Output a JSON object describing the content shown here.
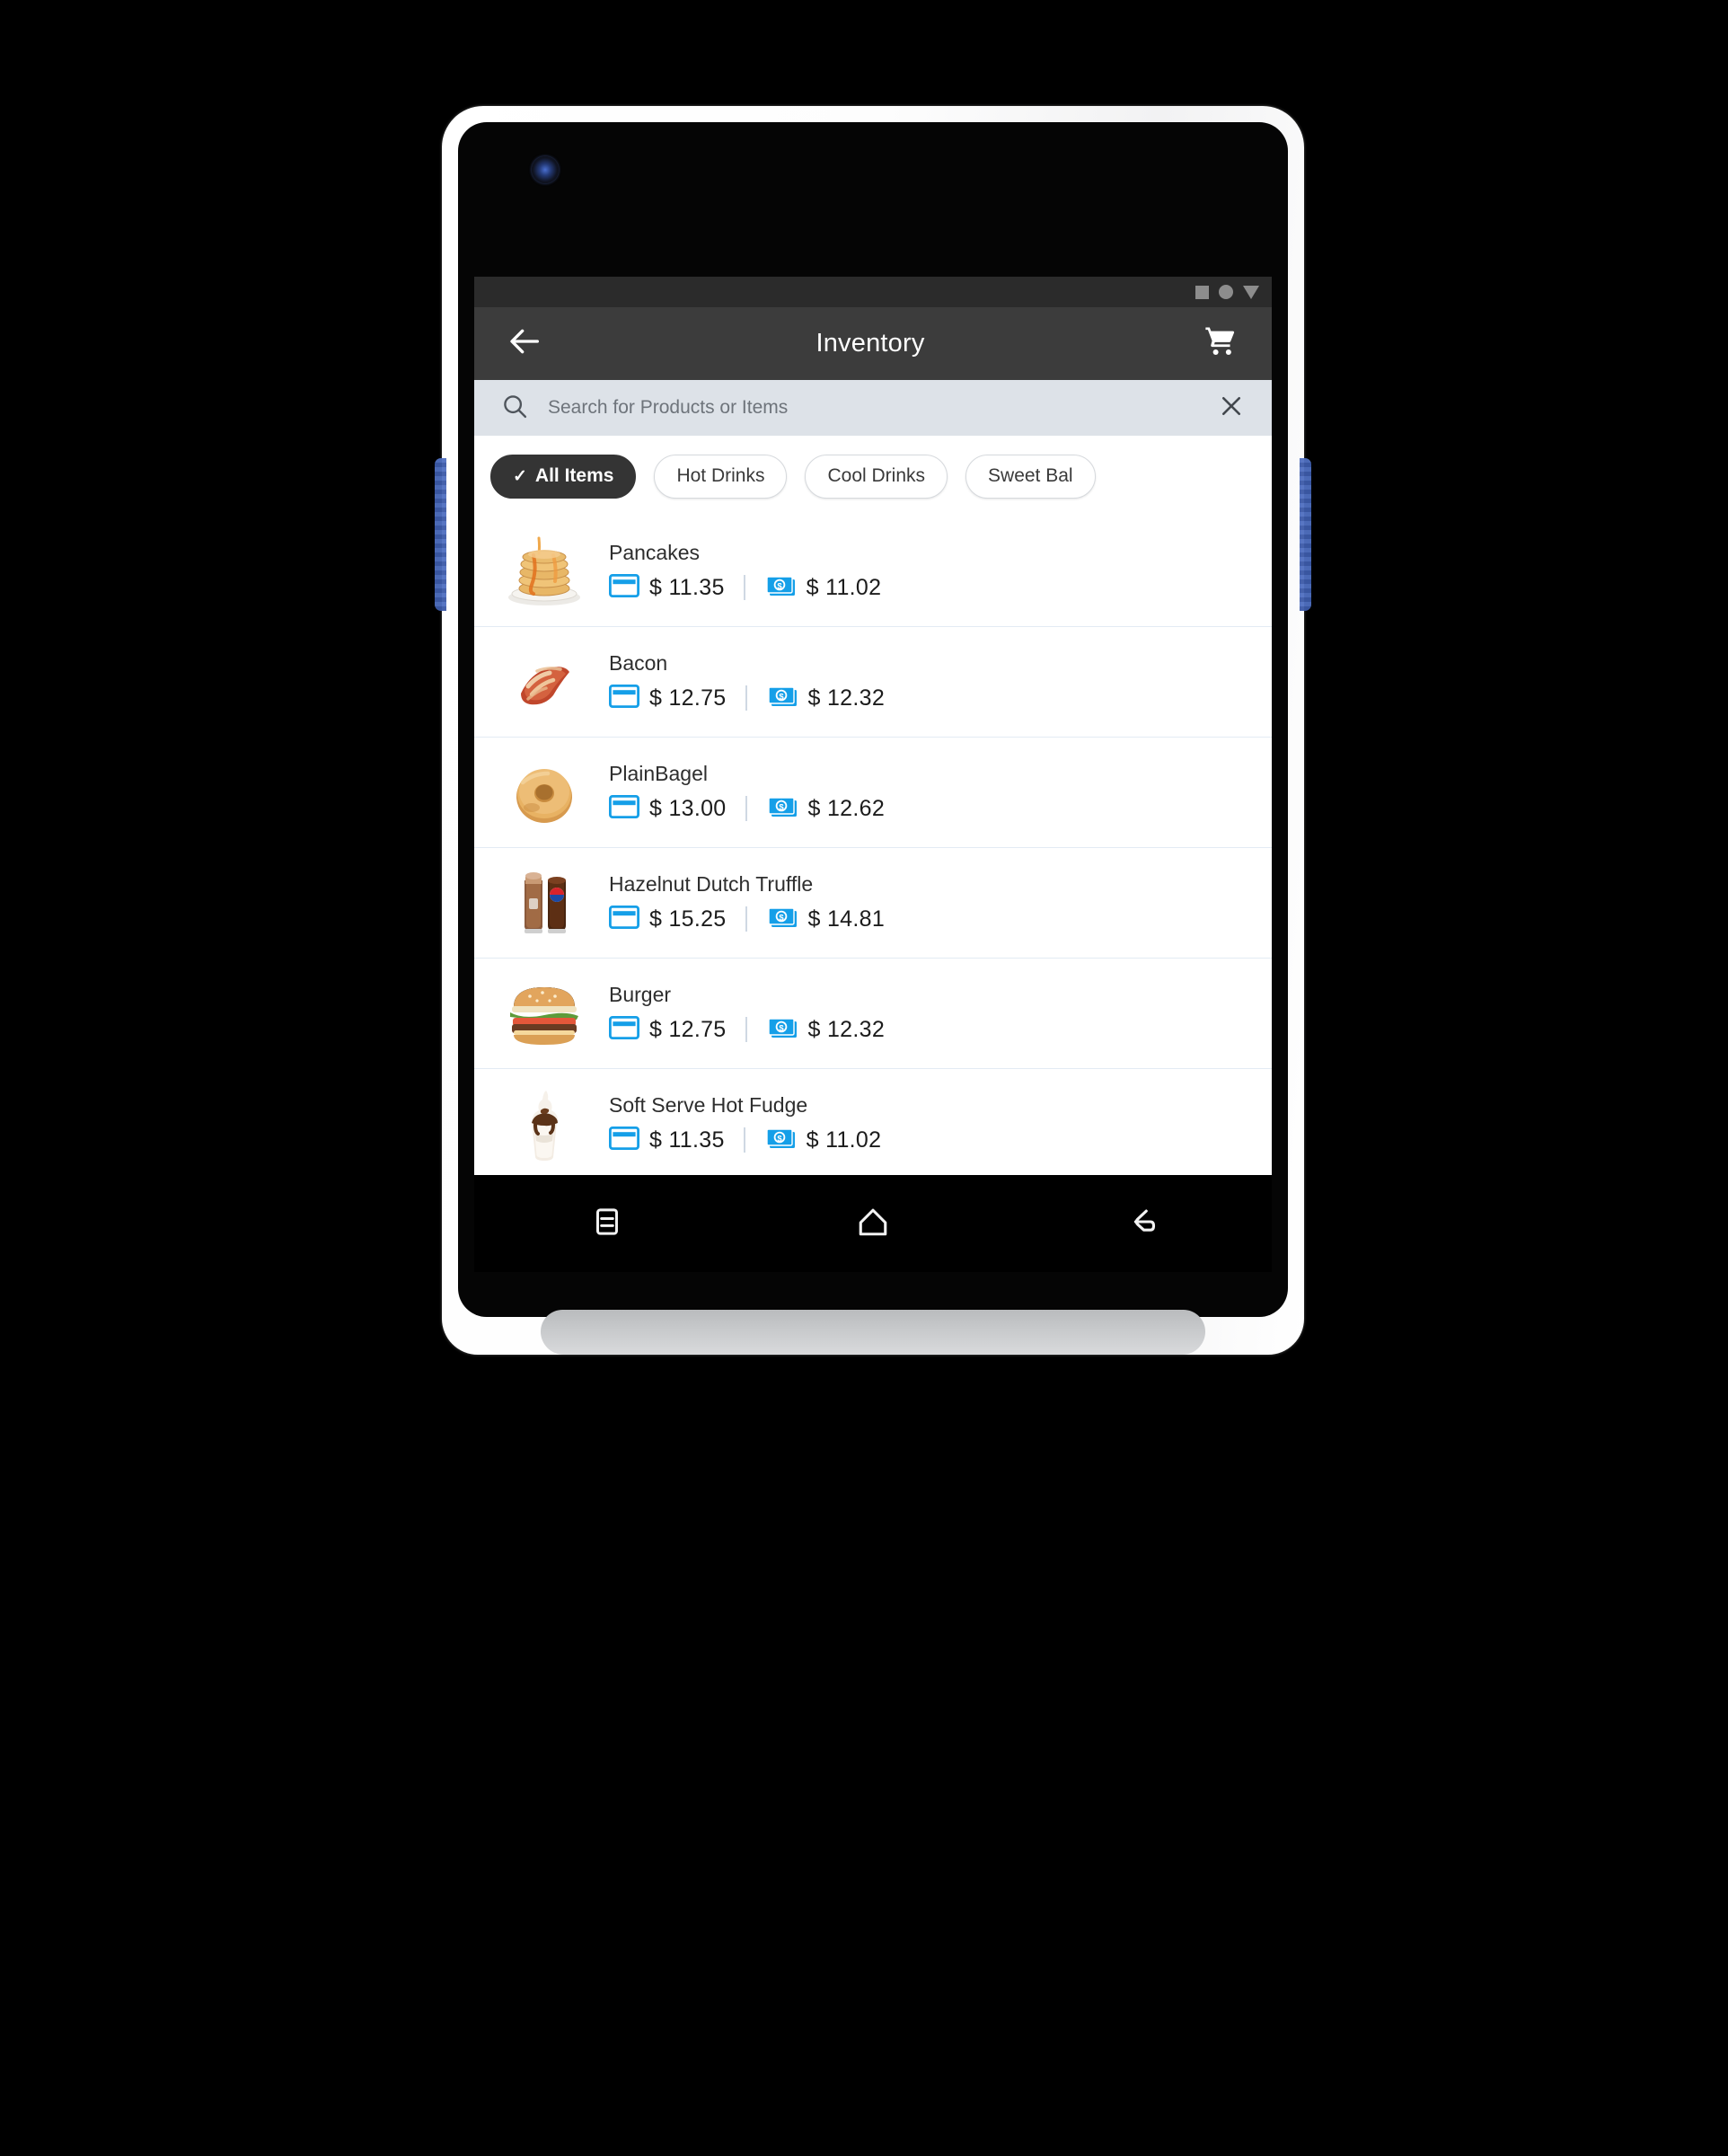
{
  "device": {
    "camera_icon": "camera-lens",
    "side_button_left": "volume-button-left",
    "side_button_right": "volume-button-right"
  },
  "status_bar": {
    "icons": [
      "square-icon",
      "circle-icon",
      "triangle-down-icon"
    ]
  },
  "app_bar": {
    "back_icon": "arrow-left-icon",
    "title": "Inventory",
    "cart_icon": "shopping-cart-icon"
  },
  "search": {
    "search_icon": "search-icon",
    "placeholder": "Search for Products or Items",
    "value": "",
    "clear_icon": "close-x-icon"
  },
  "chips": [
    {
      "label": "All Items",
      "selected": true,
      "check": "✓"
    },
    {
      "label": "Hot Drinks",
      "selected": false
    },
    {
      "label": "Cool Drinks",
      "selected": false
    },
    {
      "label": "Sweet Bal",
      "selected": false
    }
  ],
  "price_labels": {
    "card_icon": "credit-card-icon",
    "cash_icon": "cash-banknote-icon"
  },
  "products": [
    {
      "name": "Pancakes",
      "thumb": "pancakes-image",
      "card_price": "$ 11.35",
      "cash_price": "$ 11.02"
    },
    {
      "name": "Bacon",
      "thumb": "bacon-image",
      "card_price": "$ 12.75",
      "cash_price": "$ 12.32"
    },
    {
      "name": "PlainBagel",
      "thumb": "bagel-image",
      "card_price": "$ 13.00",
      "cash_price": "$ 12.62"
    },
    {
      "name": "Hazelnut Dutch Truffle",
      "thumb": "drinks-image",
      "card_price": "$ 15.25",
      "cash_price": "$ 14.81"
    },
    {
      "name": "Burger",
      "thumb": "burger-image",
      "card_price": "$ 12.75",
      "cash_price": "$ 12.32"
    },
    {
      "name": "Soft Serve Hot Fudge",
      "thumb": "soft-serve-image",
      "card_price": "$ 11.35",
      "cash_price": "$ 11.02"
    }
  ],
  "nav_bar": {
    "recents_icon": "recents-icon",
    "home_icon": "home-icon",
    "back_icon": "back-arrow-icon"
  },
  "colors": {
    "accent_blue": "#159FE8",
    "app_bar": "#3c3c3c",
    "status_bar": "#2b2b2b",
    "search_bar": "#dde2e8",
    "chip_selected": "#343434",
    "divider": "#e3ebf4"
  }
}
